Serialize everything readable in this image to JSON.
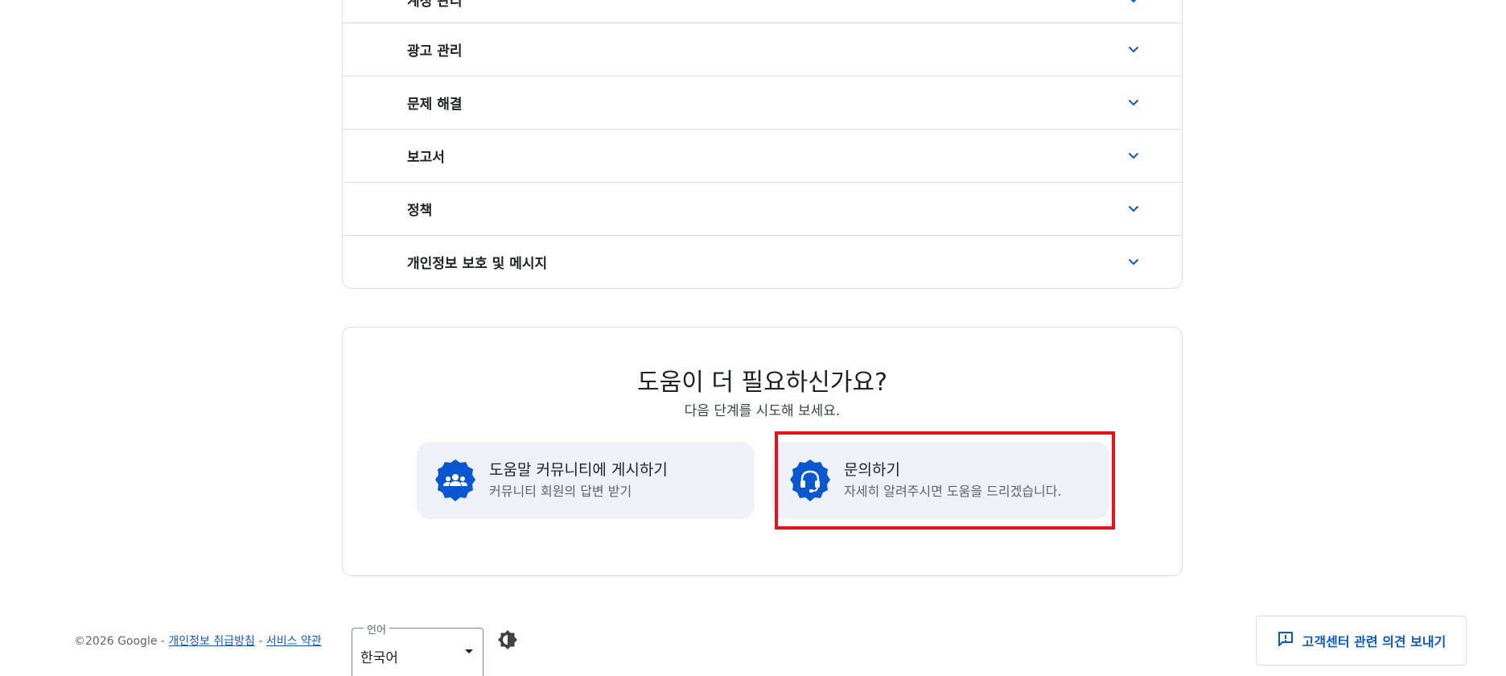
{
  "accordion": {
    "items": [
      {
        "label": "계정 관리"
      },
      {
        "label": "광고 관리"
      },
      {
        "label": "문제 해결"
      },
      {
        "label": "보고서"
      },
      {
        "label": "정책"
      },
      {
        "label": "개인정보 보호 및 메시지"
      }
    ],
    "chevron_icon": "chevron-down-icon",
    "accent_color": "#0b57d0"
  },
  "help": {
    "title": "도움이 더 필요하신가요?",
    "subtitle": "다음 단계를 시도해 보세요.",
    "options": [
      {
        "title": "도움말 커뮤니티에 게시하기",
        "description": "커뮤니티 회원의 답변 받기",
        "icon": "community-icon"
      },
      {
        "title": "문의하기",
        "description": "자세히 알려주시면 도움을 드리겠습니다.",
        "icon": "headset-icon"
      }
    ],
    "highlight_color": "#e8101a"
  },
  "footer": {
    "copyright": "©2026 Google",
    "separator": " - ",
    "privacy_link": "개인정보 취급방침",
    "terms_link": "서비스 약관",
    "language_legend": "언어",
    "language_value": "한국어",
    "theme_icon": "brightness-icon",
    "feedback_label": "고객센터 관련 의견 보내기",
    "feedback_icon": "feedback-icon"
  }
}
